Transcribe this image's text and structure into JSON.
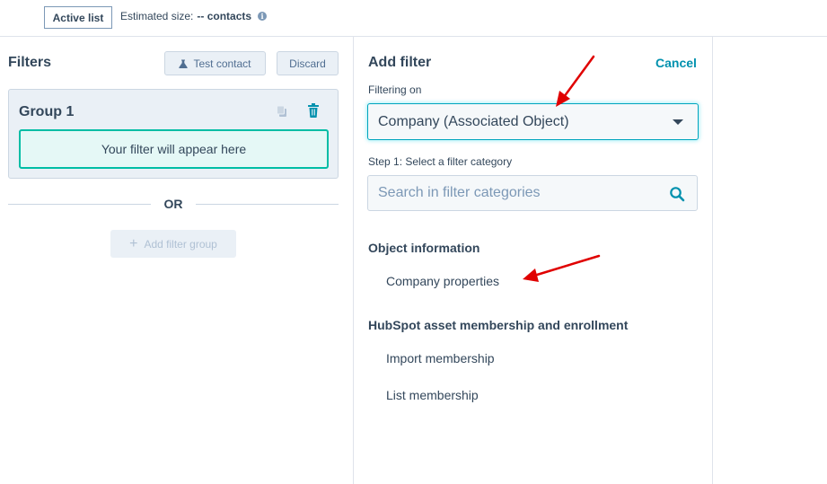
{
  "topbar": {
    "active_label": "Active list",
    "estimated_prefix": "Estimated size:",
    "estimated_value": "-- contacts",
    "info_icon": "info-icon"
  },
  "filters": {
    "title": "Filters",
    "test_contact_label": "Test contact",
    "discard_label": "Discard",
    "group": {
      "title": "Group 1",
      "placeholder": "Your filter will appear here"
    },
    "or_label": "OR",
    "add_group_label": "Add filter group"
  },
  "add_filter": {
    "title": "Add filter",
    "cancel_label": "Cancel",
    "filtering_on_label": "Filtering on",
    "filtering_on_value": "Company (Associated Object)",
    "step1_label": "Step 1: Select a filter category",
    "search_placeholder": "Search in filter categories",
    "sections": [
      {
        "heading": "Object information",
        "items": [
          "Company properties"
        ]
      },
      {
        "heading": "HubSpot asset membership and enrollment",
        "items": [
          "Import membership",
          "List membership"
        ]
      }
    ]
  },
  "colors": {
    "accent": "#0091ae",
    "teal_border": "#00bda5",
    "text": "#33475b",
    "arrow": "#e00000"
  }
}
